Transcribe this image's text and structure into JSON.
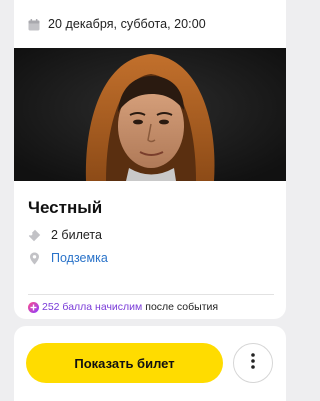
{
  "event": {
    "date_time": "20 декабря, суббота, 20:00",
    "title": "Честный",
    "tickets": "2 билета",
    "venue": "Подземка"
  },
  "bonus": {
    "points_text": "252 балла начислим",
    "suffix": "после события"
  },
  "actions": {
    "show_ticket_label": "Показать билет"
  },
  "colors": {
    "accent_button": "#ffdc00",
    "link": "#2a73c9",
    "points": "#7a3bd8",
    "background": "#eeeef0"
  },
  "icons": {
    "date": "calendar-icon",
    "tickets": "ticket-icon",
    "venue": "location-pin-icon",
    "points": "plus-points-icon",
    "more": "more-vertical-icon"
  }
}
